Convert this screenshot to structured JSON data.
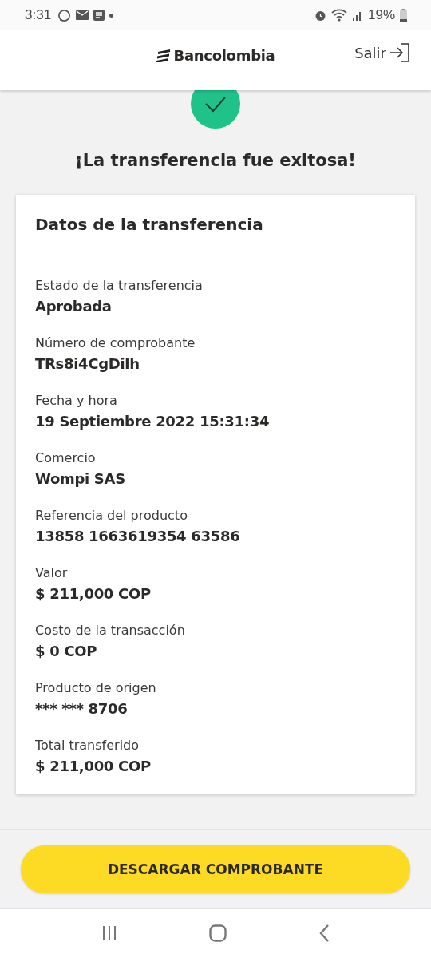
{
  "status_bar": {
    "time": "3:31",
    "battery": "19%"
  },
  "header": {
    "brand": "Bancolombia",
    "logout": "Salir"
  },
  "message": "¡La transferencia fue exitosa!",
  "card": {
    "title": "Datos de la transferencia",
    "fields": [
      {
        "label": "Estado de la transferencia",
        "value": "Aprobada"
      },
      {
        "label": "Número de comprobante",
        "value": "TRs8i4CgDilh"
      },
      {
        "label": "Fecha y hora",
        "value": "19 Septiembre 2022 15:31:34"
      },
      {
        "label": "Comercio",
        "value": "Wompi SAS"
      },
      {
        "label": "Referencia del producto",
        "value": "13858 1663619354 63586"
      },
      {
        "label": "Valor",
        "value": "$ 211,000 COP"
      },
      {
        "label": "Costo de la transacción",
        "value": "$ 0 COP"
      },
      {
        "label": "Producto de origen",
        "value": "*** *** 8706"
      },
      {
        "label": "Total transferido",
        "value": "$ 211,000 COP"
      }
    ]
  },
  "download_button": "DESCARGAR COMPROBANTE"
}
